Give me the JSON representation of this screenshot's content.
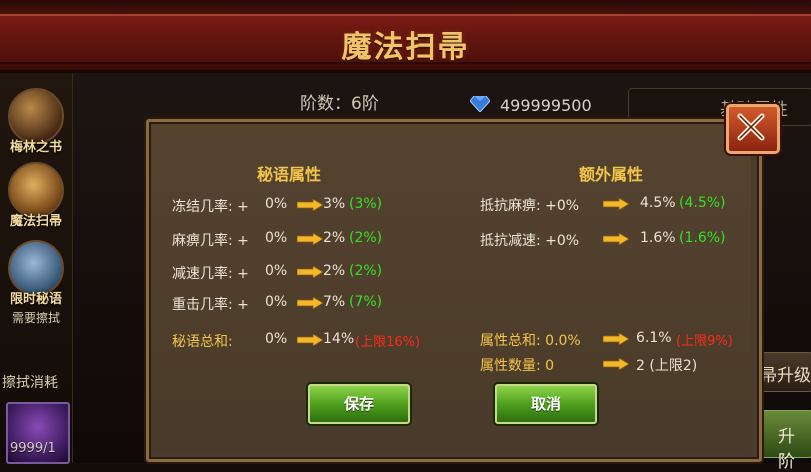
{
  "header": {
    "title": "魔法扫帚"
  },
  "sidebar": {
    "items": [
      {
        "label": "梅林之书",
        "sub": ""
      },
      {
        "label": "魔法扫帚",
        "sub": ""
      },
      {
        "label": "限时秘语",
        "sub": "需要擦拭"
      }
    ],
    "consume_label": "擦拭消耗",
    "item_count": "9999/1"
  },
  "status": {
    "tier": "阶数：6阶",
    "diamonds": "499999500"
  },
  "right": {
    "attr_tab": "基础属性",
    "upgrade": "帚升级",
    "advance": "升阶"
  },
  "modal": {
    "secret_title": "秘语属性",
    "extra_title": "额外属性",
    "secret_rows": [
      {
        "label": "冻结几率: +",
        "cur": "0%",
        "new": "3%",
        "delta": "(3%)"
      },
      {
        "label": "麻痹几率: +",
        "cur": "0%",
        "new": "2%",
        "delta": "(2%)"
      },
      {
        "label": "减速几率: +",
        "cur": "0%",
        "new": "2%",
        "delta": "(2%)"
      },
      {
        "label": "重击几率: +",
        "cur": "0%",
        "new": "7%",
        "delta": "(7%)"
      }
    ],
    "secret_total": {
      "label": "秘语总和:",
      "cur": "0%",
      "new": "14%",
      "cap": "(上限16%)"
    },
    "extra_rows": [
      {
        "label": "抵抗麻痹: +0%",
        "new": "4.5%",
        "delta": "(4.5%)"
      },
      {
        "label": "抵抗减速: +0%",
        "new": "1.6%",
        "delta": "(1.6%)"
      }
    ],
    "extra_total": {
      "label": "属性总和: 0.0%",
      "new": "6.1%",
      "cap": "(上限9%)"
    },
    "extra_count": {
      "label": "属性数量: 0",
      "new": "2 (上限2)"
    },
    "save_label": "保存",
    "cancel_label": "取消"
  },
  "colors": {
    "gold": "#f3c54a",
    "green": "#36e026",
    "red": "#ff2a1a",
    "button": "#4fa01e"
  }
}
